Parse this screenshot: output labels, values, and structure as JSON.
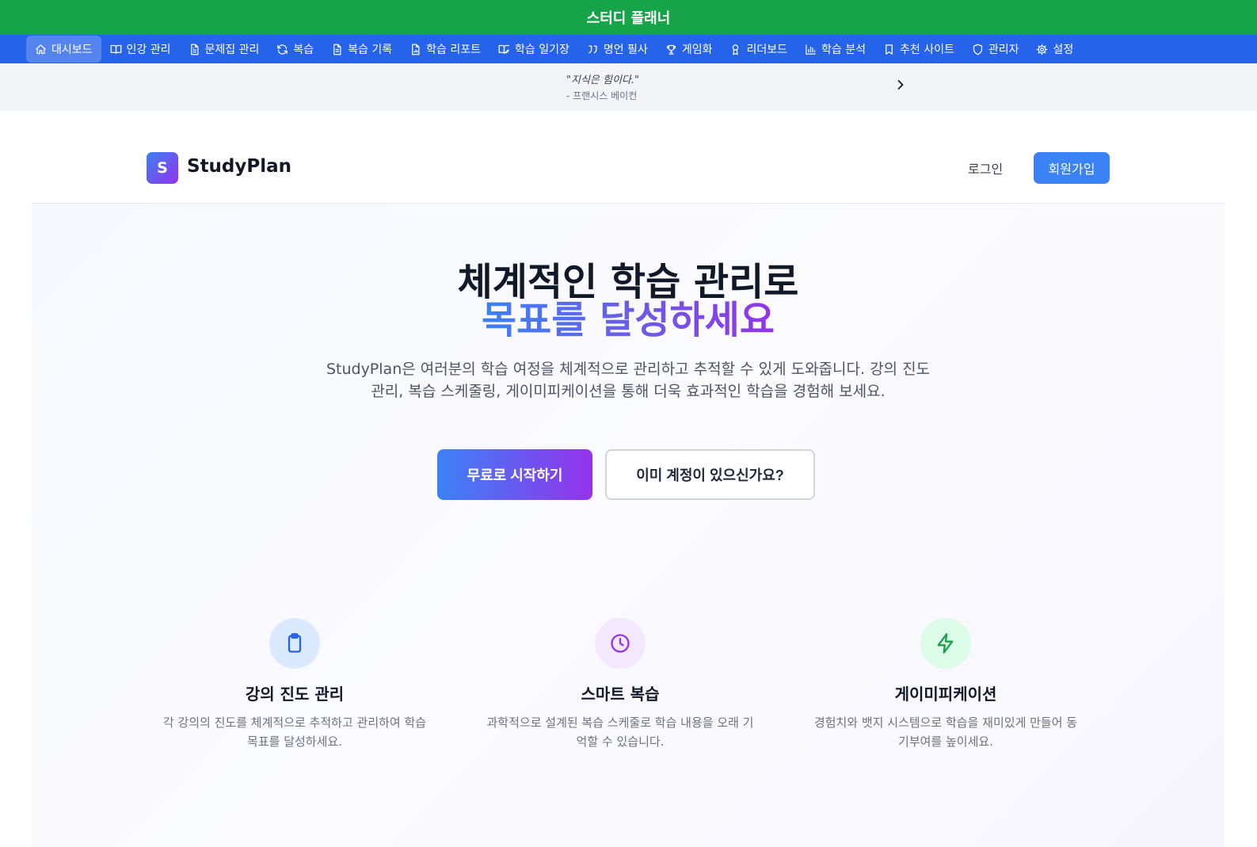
{
  "app_title": "스터디 플래너",
  "nav": {
    "items": [
      {
        "label": "대시보드",
        "icon": "home-icon",
        "active": true
      },
      {
        "label": "인강 관리",
        "icon": "book-open-icon"
      },
      {
        "label": "문제집 관리",
        "icon": "file-text-icon"
      },
      {
        "label": "복습",
        "icon": "refresh-icon"
      },
      {
        "label": "복습 기록",
        "icon": "file-list-icon"
      },
      {
        "label": "학습 리포트",
        "icon": "file-chart-icon"
      },
      {
        "label": "학습 일기장",
        "icon": "notebook-pen-icon"
      },
      {
        "label": "명언 필사",
        "icon": "quote-icon"
      },
      {
        "label": "게임화",
        "icon": "trophy-icon"
      },
      {
        "label": "리더보드",
        "icon": "award-icon"
      },
      {
        "label": "학습 분석",
        "icon": "bar-chart-icon"
      },
      {
        "label": "추천 사이트",
        "icon": "bookmark-icon"
      },
      {
        "label": "관리자",
        "icon": "shield-icon"
      },
      {
        "label": "설정",
        "icon": "gear-icon"
      }
    ]
  },
  "quote": {
    "text": "\"지식은 힘이다.\"",
    "author": "- 프랜시스 베이컨"
  },
  "header": {
    "logo_letter": "S",
    "logo_text": "StudyPlan",
    "login_label": "로그인",
    "signup_label": "회원가입"
  },
  "hero": {
    "title_line1": "체계적인 학습 관리로",
    "title_line2": "목표를 달성하세요",
    "description": "StudyPlan은 여러분의 학습 여정을 체계적으로 관리하고 추적할 수 있게 도와줍니다. 강의 진도 관리, 복습 스케줄링, 게이미피케이션을 통해 더욱 효과적인 학습을 경험해 보세요.",
    "primary_cta": "무료로 시작하기",
    "secondary_cta": "이미 계정이 있으신가요?"
  },
  "features": [
    {
      "icon": "clipboard-icon",
      "title": "강의 진도 관리",
      "description": "각 강의의 진도를 체계적으로 추적하고 관리하여 학습 목표를 달성하세요."
    },
    {
      "icon": "clock-icon",
      "title": "스마트 복습",
      "description": "과학적으로 설계된 복습 스케줄로 학습 내용을 오래 기억할 수 있습니다."
    },
    {
      "icon": "lightning-icon",
      "title": "게이미피케이션",
      "description": "경험치와 뱃지 시스템으로 학습을 재미있게 만들어 동기부여를 높이세요."
    }
  ],
  "colors": {
    "banner": "#16a34a",
    "nav": "#2563eb",
    "brand_blue": "#3b82f6",
    "brand_purple": "#9333ea",
    "feature_blue_bg": "#dbeafe",
    "feature_purple_bg": "#f3e8ff",
    "feature_green_bg": "#dcfce7"
  }
}
